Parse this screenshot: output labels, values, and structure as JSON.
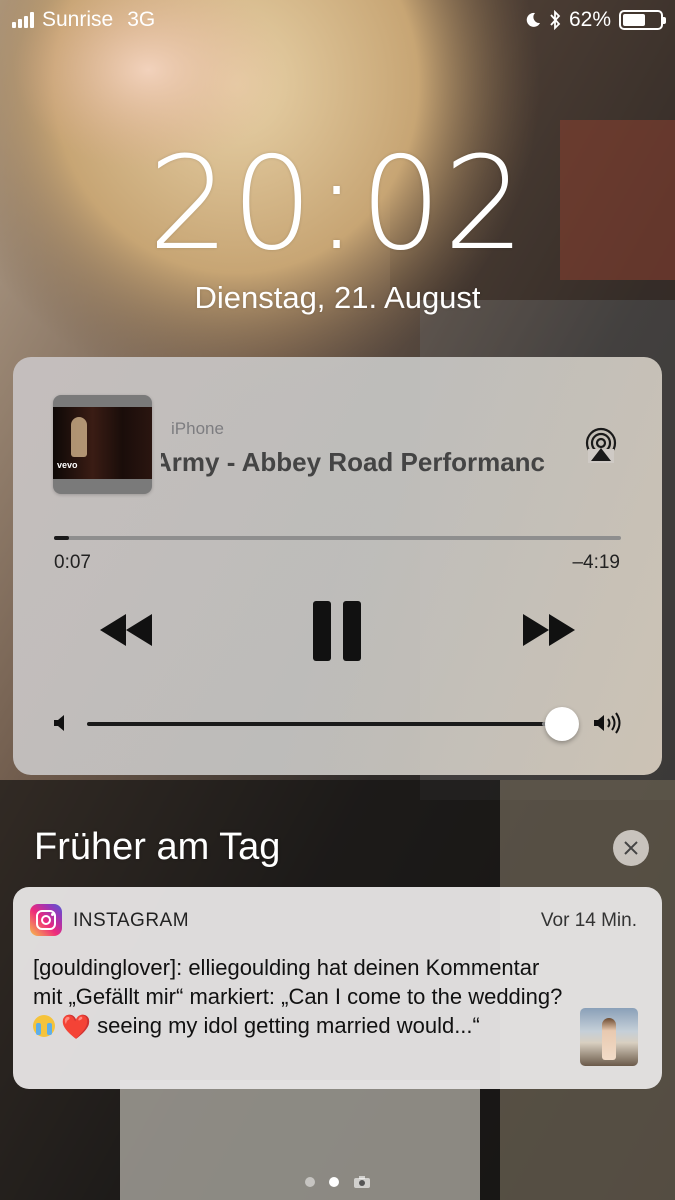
{
  "status_bar": {
    "carrier": "Sunrise",
    "network": "3G",
    "battery": "62%",
    "battery_level": 0.62
  },
  "lock_screen": {
    "time": "20:02",
    "date": "Dienstag, 21. August"
  },
  "now_playing": {
    "source": "iPhone",
    "track_title": "Army - Abbey Road Performanc",
    "elapsed": "0:07",
    "remaining": "–4:19",
    "progress": 0.027,
    "volume": 0.96,
    "artwork_label": "vevo"
  },
  "notifications": {
    "section_title": "Früher am Tag",
    "items": [
      {
        "app": "INSTAGRAM",
        "time": "Vor 14 Min.",
        "body_part1": "[gouldinglover]: elliegoulding hat deinen Kommentar mit „Gefällt mir“ markiert: „Can I come to the wedding?",
        "body_heart": "❤️",
        "body_part2": " seeing my idol getting married would...“"
      }
    ]
  },
  "colors": {
    "progress_fill": "#1a1a1a",
    "track_empty": "#8e8e8e",
    "heart": "#e02424"
  }
}
